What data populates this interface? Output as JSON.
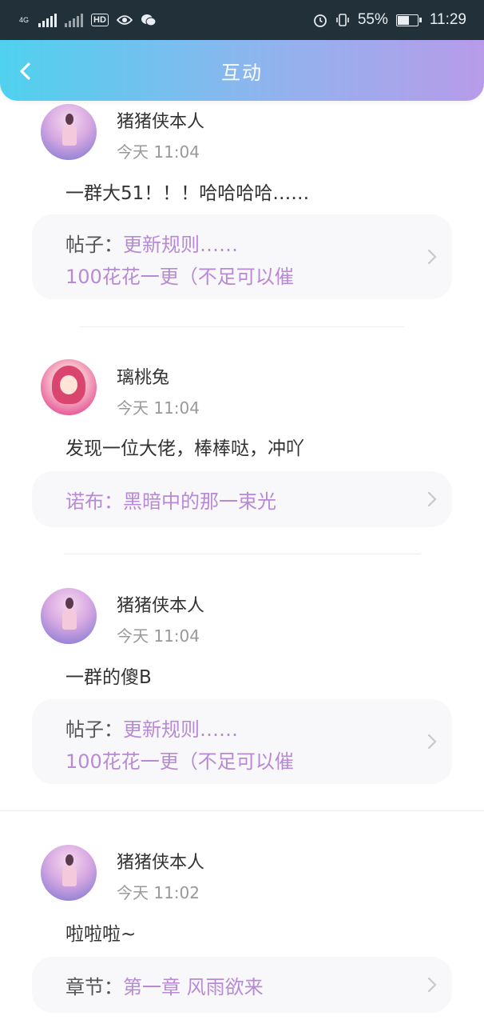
{
  "status_bar": {
    "net_left": "4G",
    "hd": "HD",
    "battery_percent": "55%",
    "time": "11:29"
  },
  "header": {
    "title": "互动"
  },
  "posts": [
    {
      "username": "猪猪侠本人",
      "time": "今天 11:04",
      "content": "一群大51！！！哈哈哈哈……",
      "ref_label": "帖子：",
      "ref_line1": "更新规则……",
      "ref_line2": "100花花一更（不足可以催"
    },
    {
      "username": "璃桃兔",
      "time": "今天 11:04",
      "content": "发现一位大佬，棒棒哒，冲吖",
      "ref_label": "诺布：",
      "ref_line1": "黑暗中的那一束光"
    },
    {
      "username": "猪猪侠本人",
      "time": "今天 11:04",
      "content": "一群的傻B",
      "ref_label": "帖子：",
      "ref_line1": "更新规则……",
      "ref_line2": "100花花一更（不足可以催"
    },
    {
      "username": "猪猪侠本人",
      "time": "今天 11:02",
      "content": "啦啦啦~",
      "ref_label": "章节：",
      "ref_line1": "第一章 风雨欲来"
    }
  ]
}
